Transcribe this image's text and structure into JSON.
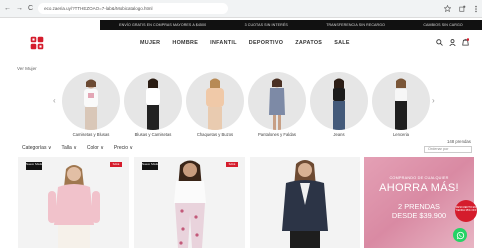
{
  "browser": {
    "back_glyph": "←",
    "forward_glyph": "→",
    "reload_glyph": "C",
    "url": "eco.zaeria.uy/?TTHEZOAO=7-lab&/Mobicatalogo.html"
  },
  "promo_strip": [
    "ENVÍO GRATIS EN COMPRAS MAYORES A $4500",
    "3 CUOTAS SIN INTERÉS",
    "TRANSFERENCIA SIN RECARGO",
    "CAMBIOS SIN CARGO"
  ],
  "nav": {
    "items": [
      "MUJER",
      "HOMBRE",
      "INFANTIL",
      "DEPORTIVO",
      "ZAPATOS",
      "SALE"
    ]
  },
  "breadcrumb": "Ver Mujer",
  "categories": [
    {
      "label": "Camisetas y Blusas"
    },
    {
      "label": "Blusas y Camisetas"
    },
    {
      "label": "Chaquetas y Buzos"
    },
    {
      "label": "Pantalones y Faldas"
    },
    {
      "label": "Jeans"
    },
    {
      "label": "Lenceria"
    }
  ],
  "filters": [
    "Categorías ∨",
    "Talla ∨",
    "Color ∨",
    "Precio ∨"
  ],
  "results_label": "148 prendas",
  "sort_placeholder": "Ordenar por",
  "products": [
    {
      "new_tag": "Nuevo SALE",
      "sale_tag": "SALE"
    },
    {
      "new_tag": "Nuevo SALE",
      "sale_tag": "SALE"
    },
    {
      "new_tag": "",
      "sale_tag": ""
    }
  ],
  "ad": {
    "line1": "COMPRANDO DE CUALQUIER",
    "line2": "AHORRA MÁS!",
    "line3": "2 PRENDAS",
    "line4": "DESDE $39.900"
  },
  "round_badge": "DESCUENTO EN TIENDA 35% OFF",
  "colors": {
    "accent": "#d51c2c",
    "promo_strip": "#111111",
    "ad_bg": "#e4a0b5",
    "whatsapp": "#25d366"
  }
}
